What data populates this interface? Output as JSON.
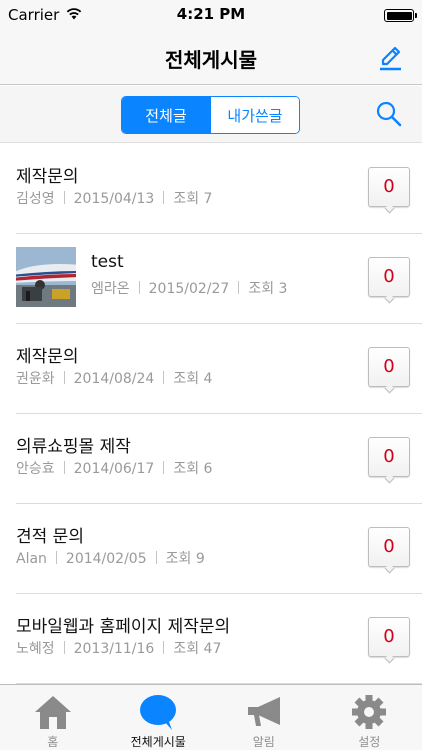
{
  "status_bar": {
    "carrier": "Carrier",
    "time": "4:21 PM"
  },
  "nav": {
    "title": "전체게시물",
    "compose_icon": "pencil-icon",
    "accent": "#0a84ff"
  },
  "filter": {
    "tabs": [
      {
        "label": "전체글",
        "active": true
      },
      {
        "label": "내가쓴글",
        "active": false
      }
    ],
    "search_icon": "search-icon"
  },
  "posts": [
    {
      "title": "제작문의",
      "author": "김성영",
      "date": "2015/04/13",
      "views": "조회 7",
      "comments": "0",
      "has_thumbnail": false
    },
    {
      "title": "test",
      "author": "엠라온",
      "date": "2015/02/27",
      "views": "조회 3",
      "comments": "0",
      "has_thumbnail": true
    },
    {
      "title": "제작문의",
      "author": "권윤화",
      "date": "2014/08/24",
      "views": "조회 4",
      "comments": "0",
      "has_thumbnail": false
    },
    {
      "title": "의류쇼핑몰 제작",
      "author": "안승효",
      "date": "2014/06/17",
      "views": "조회 6",
      "comments": "0",
      "has_thumbnail": false
    },
    {
      "title": "견적 문의",
      "author": "Alan",
      "date": "2014/02/05",
      "views": "조회 9",
      "comments": "0",
      "has_thumbnail": false
    },
    {
      "title": "모바일웹과 홈페이지 제작문의",
      "author": "노혜정",
      "date": "2013/11/16",
      "views": "조회 47",
      "comments": "0",
      "has_thumbnail": false
    }
  ],
  "tab_bar": {
    "items": [
      {
        "label": "홈",
        "icon": "home-icon",
        "active": false
      },
      {
        "label": "전체게시물",
        "icon": "speech-bubble-icon",
        "active": true
      },
      {
        "label": "알림",
        "icon": "megaphone-icon",
        "active": false
      },
      {
        "label": "설정",
        "icon": "gear-icon",
        "active": false
      }
    ]
  }
}
